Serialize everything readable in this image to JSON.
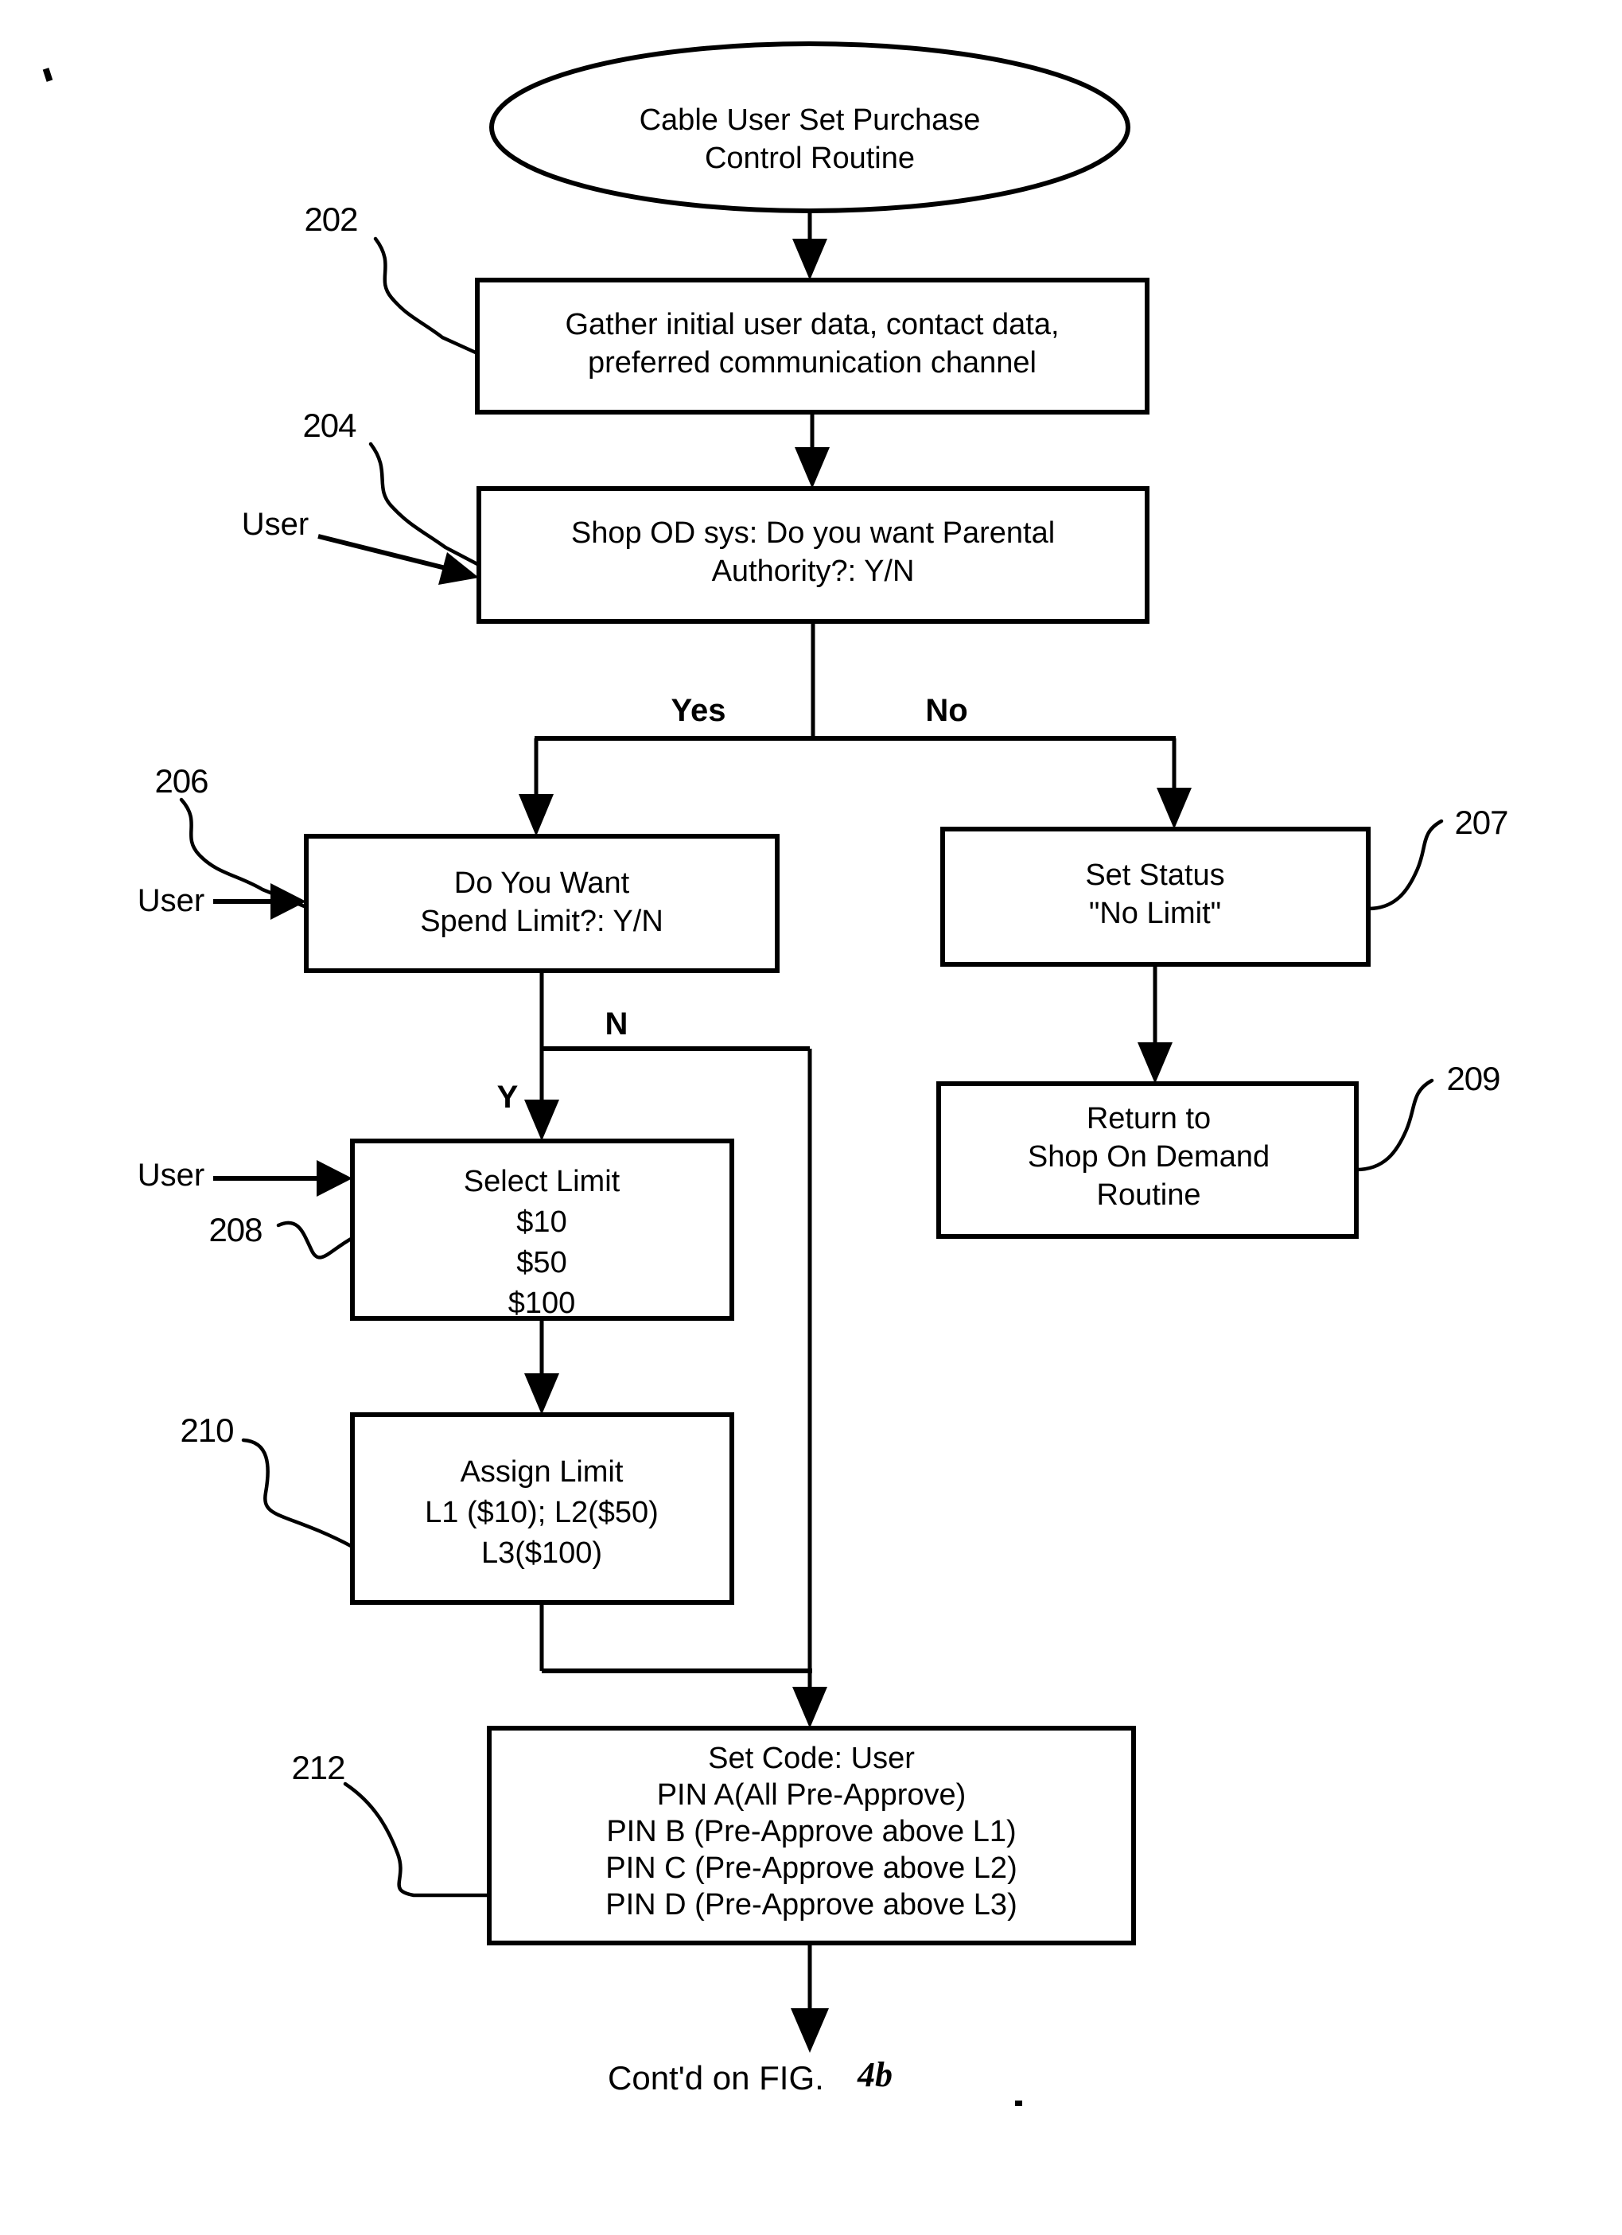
{
  "figure": {
    "kind": "patent-flowchart",
    "title_shape": "ellipse",
    "footer": "Cont'd on FIG.",
    "footer_figure_number": "4b"
  },
  "nodes": {
    "start": {
      "ref": "",
      "shape": "ellipse",
      "lines": [
        "Cable User Set Purchase",
        "Control Routine"
      ]
    },
    "n202": {
      "ref": "202",
      "shape": "process",
      "lines": [
        "Gather initial user data, contact data,",
        "preferred communication channel"
      ]
    },
    "n204": {
      "ref": "204",
      "shape": "process",
      "lines": [
        "Shop OD sys: Do you want Parental",
        "Authority?: Y/N"
      ]
    },
    "n206": {
      "ref": "206",
      "shape": "process",
      "lines": [
        "Do You Want",
        "Spend Limit?: Y/N"
      ]
    },
    "n207": {
      "ref": "207",
      "shape": "process",
      "lines": [
        "Set Status",
        "\"No Limit\""
      ]
    },
    "n208": {
      "ref": "208",
      "shape": "process",
      "lines": [
        "Select Limit",
        "$10",
        "$50",
        "$100"
      ]
    },
    "n209": {
      "ref": "209",
      "shape": "process",
      "lines": [
        "Return to",
        "Shop On Demand",
        "Routine"
      ]
    },
    "n210": {
      "ref": "210",
      "shape": "process",
      "lines": [
        "Assign Limit",
        "L1 ($10); L2($50)",
        "L3($100)"
      ]
    },
    "n212": {
      "ref": "212",
      "shape": "process",
      "lines": [
        "Set Code: User",
        "PIN A(All Pre-Approve)",
        "PIN B (Pre-Approve above L1)",
        "PIN C (Pre-Approve above L2)",
        "PIN D (Pre-Approve above L3)"
      ]
    }
  },
  "branch_labels": {
    "yes": "Yes",
    "no": "No",
    "y": "Y",
    "n": "N"
  },
  "actor_labels": {
    "user_204": "User",
    "user_206": "User",
    "user_208": "User"
  },
  "colors": {
    "ink": "#000000",
    "paper": "#ffffff"
  }
}
